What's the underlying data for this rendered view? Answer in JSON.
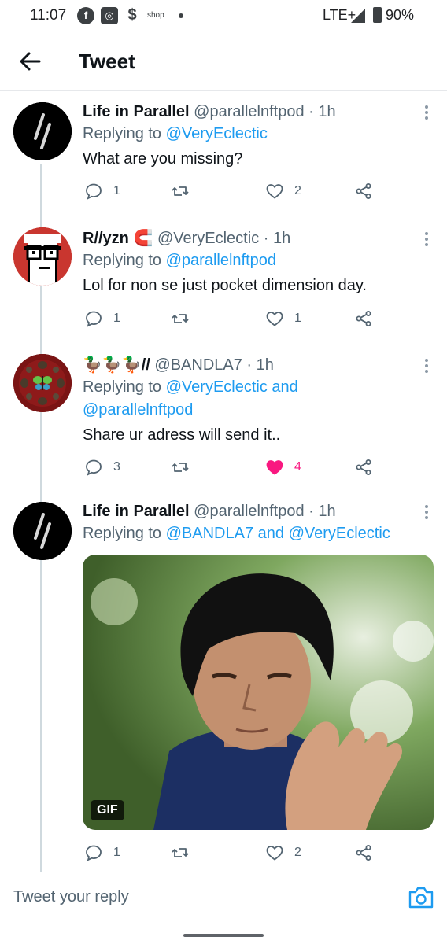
{
  "status_bar": {
    "time": "11:07",
    "shop_label": "shop",
    "network": "LTE+",
    "battery": "90%",
    "icons": [
      "facebook-icon",
      "box-icon",
      "money-icon",
      "signal-icon",
      "battery-icon"
    ]
  },
  "header": {
    "title": "Tweet",
    "back_icon": "arrow-left-icon"
  },
  "colors": {
    "accent": "#1d9bf0",
    "like_active": "#f91880",
    "muted": "#536471",
    "thread_line": "#cfd9de"
  },
  "tweets": [
    {
      "name": "Life in Parallel",
      "handle": "@parallelnftpod",
      "time": "· 1h",
      "reply_prefix": "Replying to",
      "reply_mentions": "@VeryEclectic",
      "reply_mentions_2": "",
      "text": "What are you missing?",
      "reply_count": "1",
      "retweet_count": "",
      "like_count": "2",
      "liked": false
    },
    {
      "name": "R//yzn",
      "name_emoji": "🧲",
      "handle": "@VeryEclectic",
      "time": "· 1h",
      "reply_prefix": "Replying to",
      "reply_mentions": "@parallelnftpod",
      "reply_mentions_2": "",
      "text": "Lol for non se just pocket dimension day.",
      "reply_count": "1",
      "retweet_count": "",
      "like_count": "1",
      "liked": false
    },
    {
      "name": "🦆🦆🦆//",
      "handle": "@BANDLA7",
      "time": "· 1h",
      "reply_prefix": "Replying to",
      "reply_mentions": "@VeryEclectic and",
      "reply_mentions_2": "@parallelnftpod",
      "text": "Share ur adress will send it..",
      "reply_count": "3",
      "retweet_count": "",
      "like_count": "4",
      "liked": true
    },
    {
      "name": "Life in Parallel",
      "handle": "@parallelnftpod",
      "time": "· 1h",
      "reply_prefix": "Replying to",
      "reply_mentions": "@BANDLA7 and @VeryEclectic",
      "reply_mentions_2": "",
      "text": "",
      "media_badge": "GIF",
      "reply_count": "1",
      "retweet_count": "",
      "like_count": "2",
      "liked": false
    }
  ],
  "reply_bar": {
    "placeholder": "Tweet your reply",
    "camera_icon": "camera-icon"
  }
}
